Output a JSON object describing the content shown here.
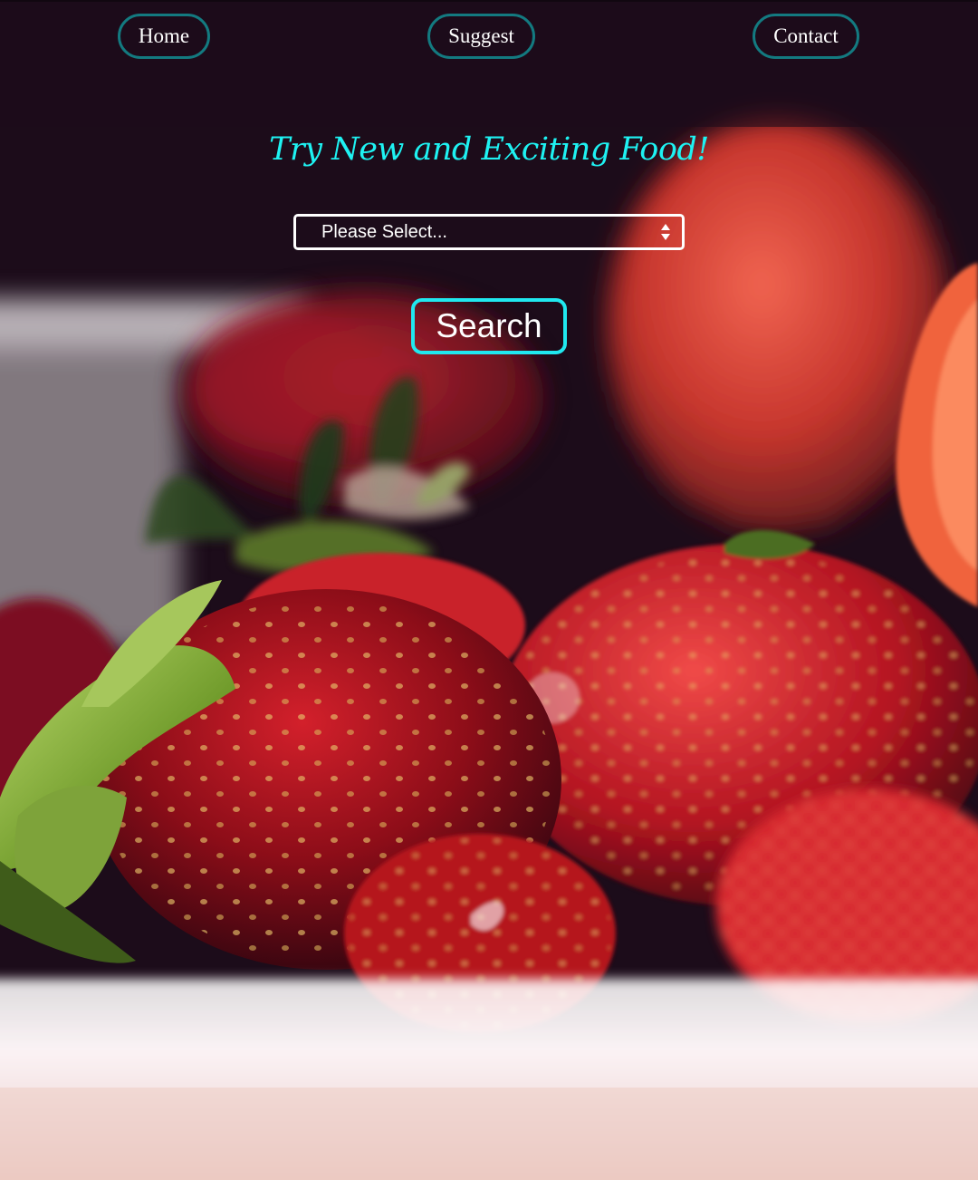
{
  "nav": {
    "items": [
      {
        "label": "Home"
      },
      {
        "label": "Suggest"
      },
      {
        "label": "Contact"
      }
    ]
  },
  "hero": {
    "headline": "Try New and Exciting Food!",
    "select": {
      "selected": "Please Select...",
      "icon": "updown-arrows-icon"
    },
    "search_label": "Search"
  },
  "background": {
    "image": "strawberries-photo",
    "colors": {
      "dark": "#1c0c1a",
      "berry_red": "#b0131c",
      "leaf_green": "#8fb63f",
      "bowl_white": "#f7eef0"
    }
  },
  "colors": {
    "accent": "#1ef2f2",
    "nav_border": "#137a80",
    "button_border": "#20e8ef"
  }
}
